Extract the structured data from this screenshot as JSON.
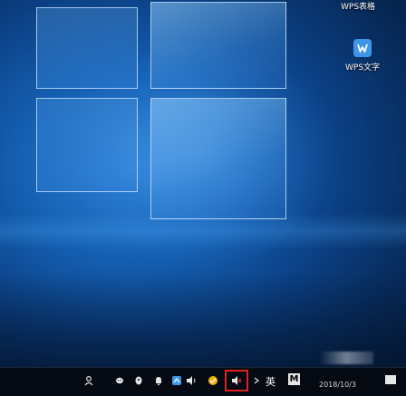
{
  "desktop": {
    "icons": [
      {
        "label": "WPS表格",
        "icon": "wps-spreadsheet-icon"
      },
      {
        "label": "WPS文字",
        "icon": "wps-writer-icon"
      }
    ]
  },
  "taskbar": {
    "tray_icons": [
      "people-icon",
      "wechat-icon",
      "qq-icon",
      "bell-icon",
      "network-icon",
      "volume-icon",
      "sync-icon",
      "volume-muted-icon",
      "chevron-icon",
      "input-ime-icon"
    ],
    "language": "英",
    "ime_badge": "M",
    "clock_date": "2018/10/3"
  },
  "colors": {
    "accent": "#3f95e8",
    "highlight": "#e02020",
    "taskbar": "#050a12"
  }
}
